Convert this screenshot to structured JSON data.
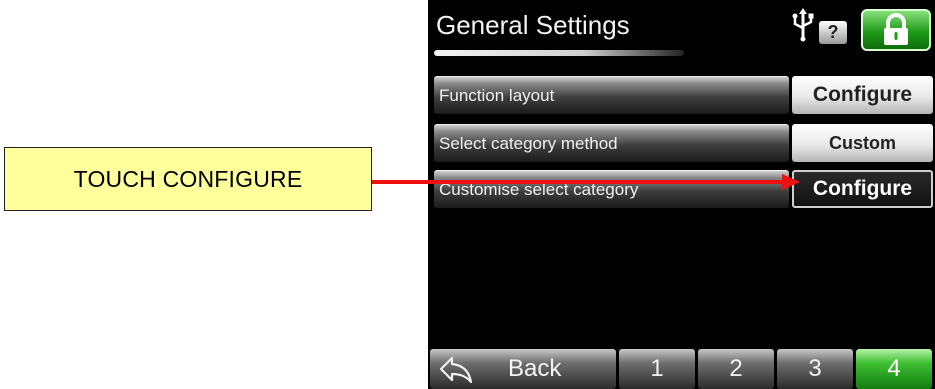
{
  "callout": {
    "text": "TOUCH CONFIGURE",
    "border_color": "#222222",
    "fill": "#ffff9c"
  },
  "arrow_color": "#ee1111",
  "header": {
    "title": "General Settings",
    "help_label": "?",
    "icons": [
      "usb-icon",
      "help-icon",
      "lock-icon"
    ]
  },
  "settings": [
    {
      "label": "Function layout",
      "button": "Configure"
    },
    {
      "label": "Select category method",
      "button": "Custom"
    },
    {
      "label": "Customise select category",
      "button": "Configure"
    }
  ],
  "footer": {
    "back_label": "Back",
    "pages": [
      "1",
      "2",
      "3",
      "4"
    ],
    "active_page": "4"
  },
  "colors": {
    "accent_green": "#1f9a18",
    "screen_bg": "#000000"
  }
}
